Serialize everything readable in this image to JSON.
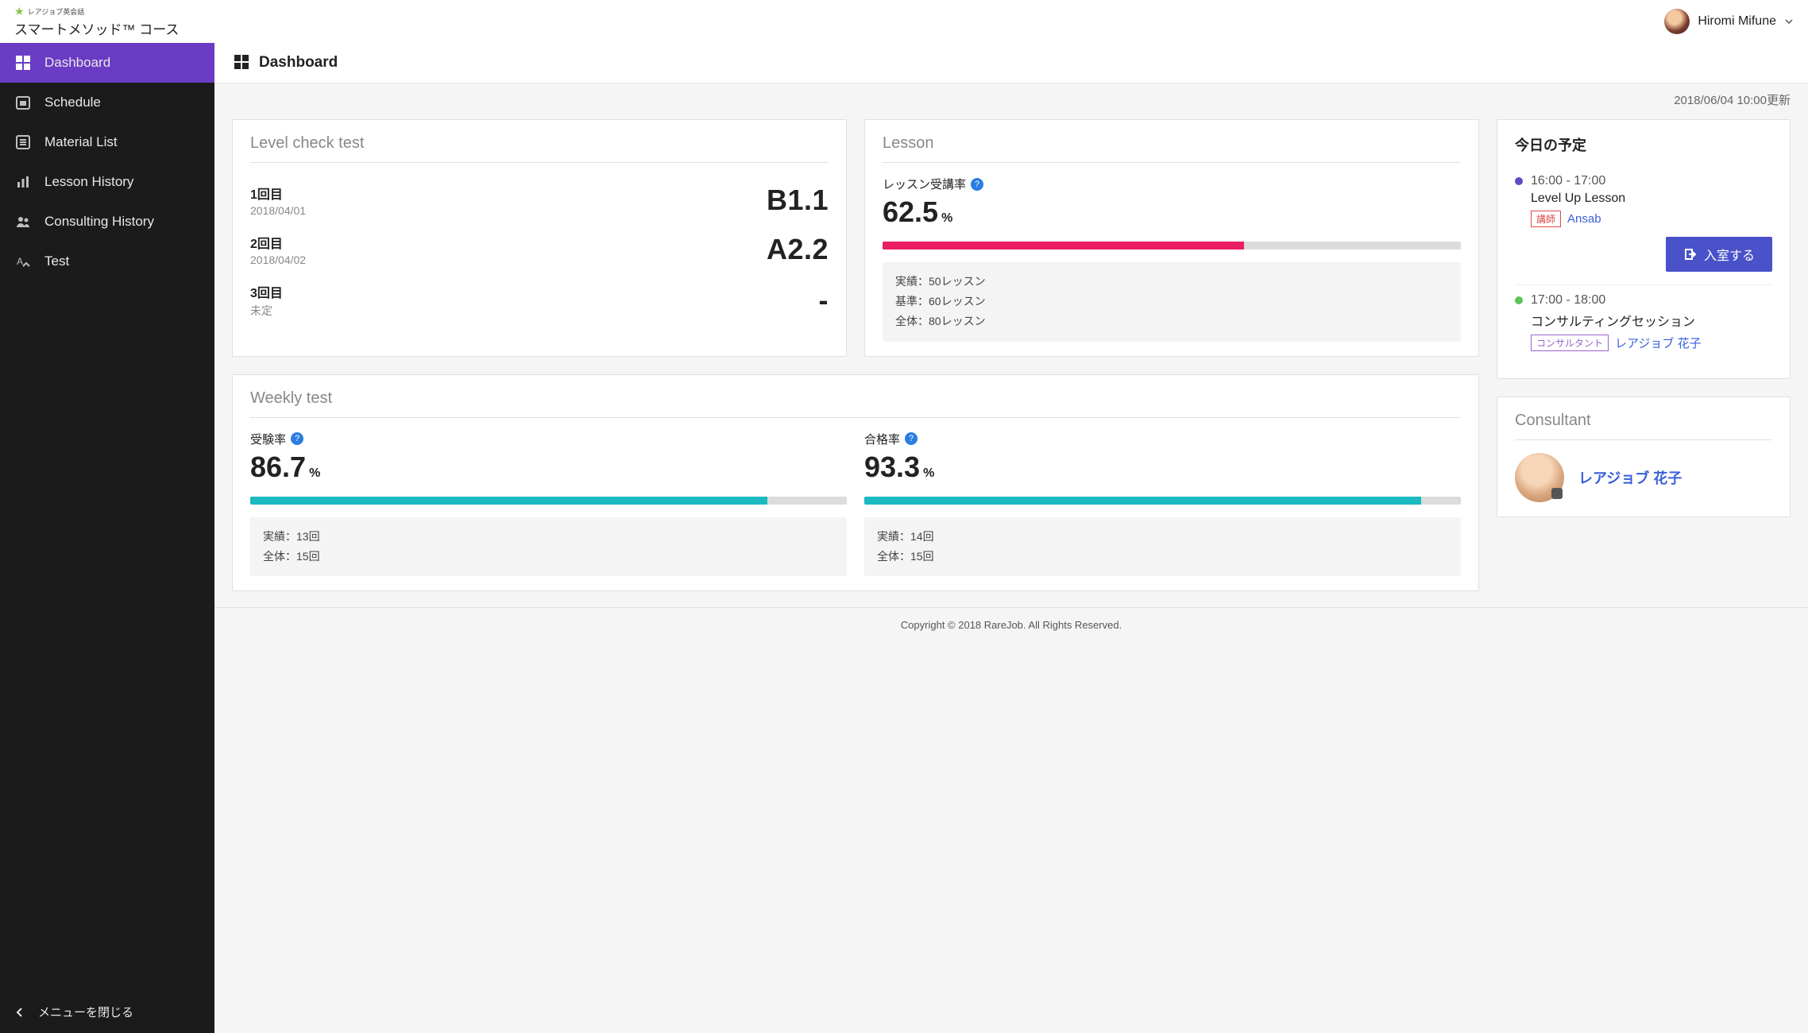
{
  "header": {
    "logo_small": "レアジョブ英会話",
    "logo_title": "スマートメソッド™ コース",
    "user_name": "Hiromi Mifune"
  },
  "sidebar": {
    "items": [
      {
        "label": "Dashboard",
        "icon": "dashboard-icon",
        "active": true
      },
      {
        "label": "Schedule",
        "icon": "calendar-icon"
      },
      {
        "label": "Material List",
        "icon": "list-icon"
      },
      {
        "label": "Lesson History",
        "icon": "chart-icon"
      },
      {
        "label": "Consulting History",
        "icon": "people-icon"
      },
      {
        "label": "Test",
        "icon": "test-icon"
      }
    ],
    "close_label": "メニューを閉じる"
  },
  "page": {
    "title": "Dashboard",
    "update_text": "2018/06/04 10:00更新"
  },
  "level_check": {
    "title": "Level check test",
    "rows": [
      {
        "label": "1回目",
        "date": "2018/04/01",
        "result": "B1.1"
      },
      {
        "label": "2回目",
        "date": "2018/04/02",
        "result": "A2.2"
      },
      {
        "label": "3回目",
        "date": "未定",
        "result": "-"
      }
    ]
  },
  "lesson": {
    "title": "Lesson",
    "rate_label": "レッスン受講率",
    "rate_value": "62.5",
    "rate_unit": "%",
    "progress_pct": 62.5,
    "details": {
      "d1": "実績：50レッスン",
      "d2": "基準：60レッスン",
      "d3": "全体：80レッスン"
    }
  },
  "weekly": {
    "title": "Weekly test",
    "exam": {
      "label": "受験率",
      "value": "86.7",
      "unit": "%",
      "progress_pct": 86.7,
      "d1": "実績：13回",
      "d2": "全体：15回"
    },
    "pass": {
      "label": "合格率",
      "value": "93.3",
      "unit": "%",
      "progress_pct": 93.3,
      "d1": "実績：14回",
      "d2": "全体：15回"
    }
  },
  "today": {
    "title": "今日の予定",
    "items": [
      {
        "time": "16:00 - 17:00",
        "name": "Level Up Lesson",
        "badge": "講師",
        "badge_color": "red",
        "person": "Ansab",
        "enter_label": "入室する",
        "dot": "blue",
        "enter": true
      },
      {
        "time": "17:00 - 18:00",
        "name": "コンサルティングセッション",
        "badge": "コンサルタント",
        "badge_color": "purple",
        "person": "レアジョブ 花子",
        "dot": "green",
        "enter": false
      }
    ]
  },
  "consultant": {
    "title": "Consultant",
    "name": "レアジョブ 花子"
  },
  "footer": {
    "copyright": "Copyright © 2018 RareJob. All Rights Reserved."
  }
}
